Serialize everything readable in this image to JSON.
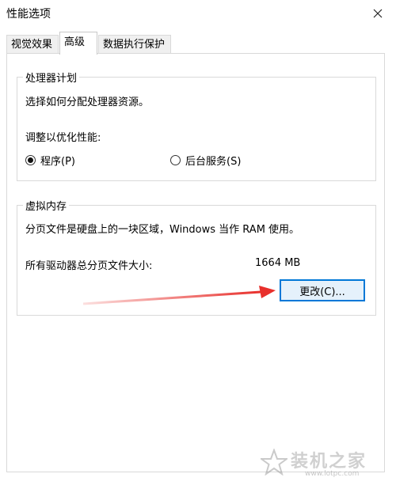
{
  "window": {
    "title": "性能选项",
    "close_icon": "close-icon"
  },
  "tabs": [
    {
      "label": "视觉效果",
      "active": false
    },
    {
      "label": "高级",
      "active": true
    },
    {
      "label": "数据执行保护",
      "active": false
    }
  ],
  "processor_group": {
    "legend": "处理器计划",
    "description": "选择如何分配处理器资源。",
    "optimize_label": "调整以优化性能:",
    "options": [
      {
        "label": "程序(P)",
        "selected": true
      },
      {
        "label": "后台服务(S)",
        "selected": false
      }
    ]
  },
  "virtual_memory_group": {
    "legend": "虚拟内存",
    "description": "分页文件是硬盘上的一块区域，Windows 当作 RAM 使用。",
    "total_label": "所有驱动器总分页文件大小:",
    "total_value": "1664 MB",
    "change_button": "更改(C)..."
  },
  "annotation": {
    "arrow_color": "#e8302c"
  },
  "watermark": {
    "text": "装机之家",
    "url": "www.lotpc.com"
  }
}
